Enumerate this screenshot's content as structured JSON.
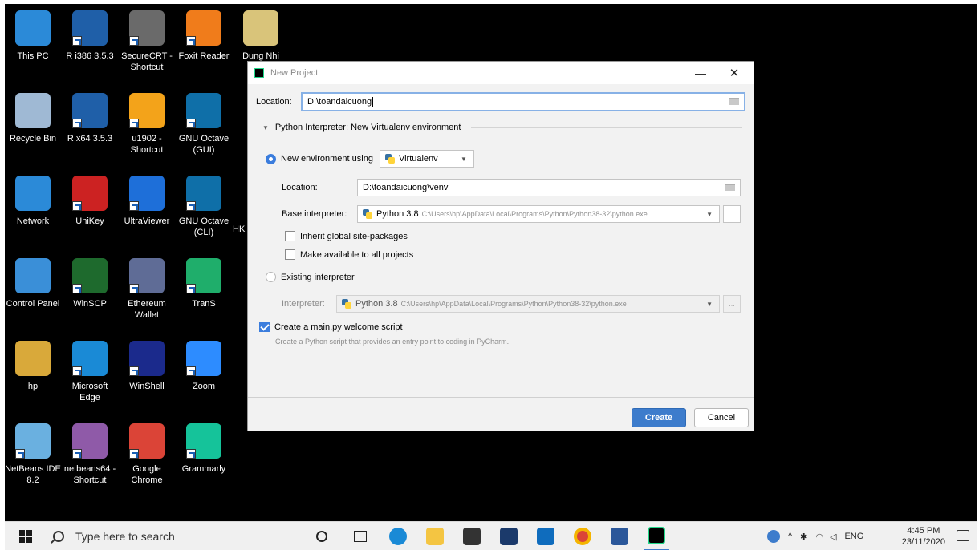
{
  "desktop": {
    "icons": [
      {
        "label": "This PC",
        "icon": "this-pc-icon",
        "color": "#2b8ad8"
      },
      {
        "label": "R i386 3.5.3",
        "icon": "r-icon",
        "color": "#1f5fa8"
      },
      {
        "label": "SecureCRT - Shortcut",
        "icon": "securecrt-icon",
        "color": "#6a6a6a"
      },
      {
        "label": "Foxit Reader",
        "icon": "foxit-icon",
        "color": "#f07c1b"
      },
      {
        "label": "Dung Nhi",
        "icon": "folder-file-icon",
        "color": "#d9c47a"
      },
      {
        "label": "Recycle Bin",
        "icon": "recycle-bin-icon",
        "color": "#9fb9d4"
      },
      {
        "label": "R x64 3.5.3",
        "icon": "r-icon",
        "color": "#1f5fa8"
      },
      {
        "label": "u1902 - Shortcut",
        "icon": "u1902-icon",
        "color": "#f3a31a"
      },
      {
        "label": "GNU Octave (GUI)",
        "icon": "octave-icon",
        "color": "#0f6fa8"
      },
      {
        "label": "Network",
        "icon": "network-icon",
        "color": "#2b8ad8"
      },
      {
        "label": "UniKey",
        "icon": "unikey-icon",
        "color": "#c22"
      },
      {
        "label": "UltraViewer",
        "icon": "ultraviewer-icon",
        "color": "#1e6fd9"
      },
      {
        "label": "GNU Octave (CLI)",
        "icon": "octave-icon",
        "color": "#0f6fa8"
      },
      {
        "label": "Control Panel",
        "icon": "control-panel-icon",
        "color": "#3a8fd8"
      },
      {
        "label": "WinSCP",
        "icon": "winscp-icon",
        "color": "#1e6a2d"
      },
      {
        "label": "Ethereum Wallet",
        "icon": "ethereum-icon",
        "color": "#5f6c96"
      },
      {
        "label": "TranS",
        "icon": "trans-icon",
        "color": "#1fae6b"
      },
      {
        "label": "hp",
        "icon": "user-folder-icon",
        "color": "#d9a93a"
      },
      {
        "label": "Microsoft Edge",
        "icon": "edge-icon",
        "color": "#1a8ad6"
      },
      {
        "label": "WinShell",
        "icon": "winshell-icon",
        "color": "#1b2a8c"
      },
      {
        "label": "Zoom",
        "icon": "zoom-icon",
        "color": "#2d8cff"
      },
      {
        "label": "NetBeans IDE 8.2",
        "icon": "netbeans-icon",
        "color": "#6ab0e0"
      },
      {
        "label": "netbeans64 - Shortcut",
        "icon": "netbeans-cube-icon",
        "color": "#8f5aa8"
      },
      {
        "label": "Google Chrome",
        "icon": "chrome-icon",
        "color": "#db4437"
      },
      {
        "label": "Grammarly",
        "icon": "grammarly-icon",
        "color": "#15c39a"
      }
    ],
    "partial_label": "HK"
  },
  "dialog": {
    "title": "New Project",
    "minimize": "—",
    "close": "✕",
    "location_label": "Location:",
    "location_value": "D:\\toandaicuong",
    "section_title": "Python Interpreter: New Virtualenv environment",
    "new_env_label": "New environment using",
    "new_env_tool": "Virtualenv",
    "venv_location_label": "Location:",
    "venv_location_value": "D:\\toandaicuong\\venv",
    "base_interpreter_label": "Base interpreter:",
    "base_interpreter_name": "Python 3.8",
    "base_interpreter_path": "C:\\Users\\hp\\AppData\\Local\\Programs\\Python\\Python38-32\\python.exe",
    "inherit_label": "Inherit global site-packages",
    "available_label": "Make available to all projects",
    "existing_label": "Existing interpreter",
    "interpreter_label": "Interpreter:",
    "interpreter_name": "Python 3.8",
    "interpreter_path": "C:\\Users\\hp\\AppData\\Local\\Programs\\Python\\Python38-32\\python.exe",
    "welcome_label": "Create a main.py welcome script",
    "welcome_desc": "Create a Python script that provides an entry point to coding in PyCharm.",
    "ellipsis": "...",
    "create_label": "Create",
    "cancel_label": "Cancel"
  },
  "taskbar": {
    "search_placeholder": "Type here to search",
    "language": "ENG",
    "time": "4:45 PM",
    "date": "23/11/2020"
  }
}
